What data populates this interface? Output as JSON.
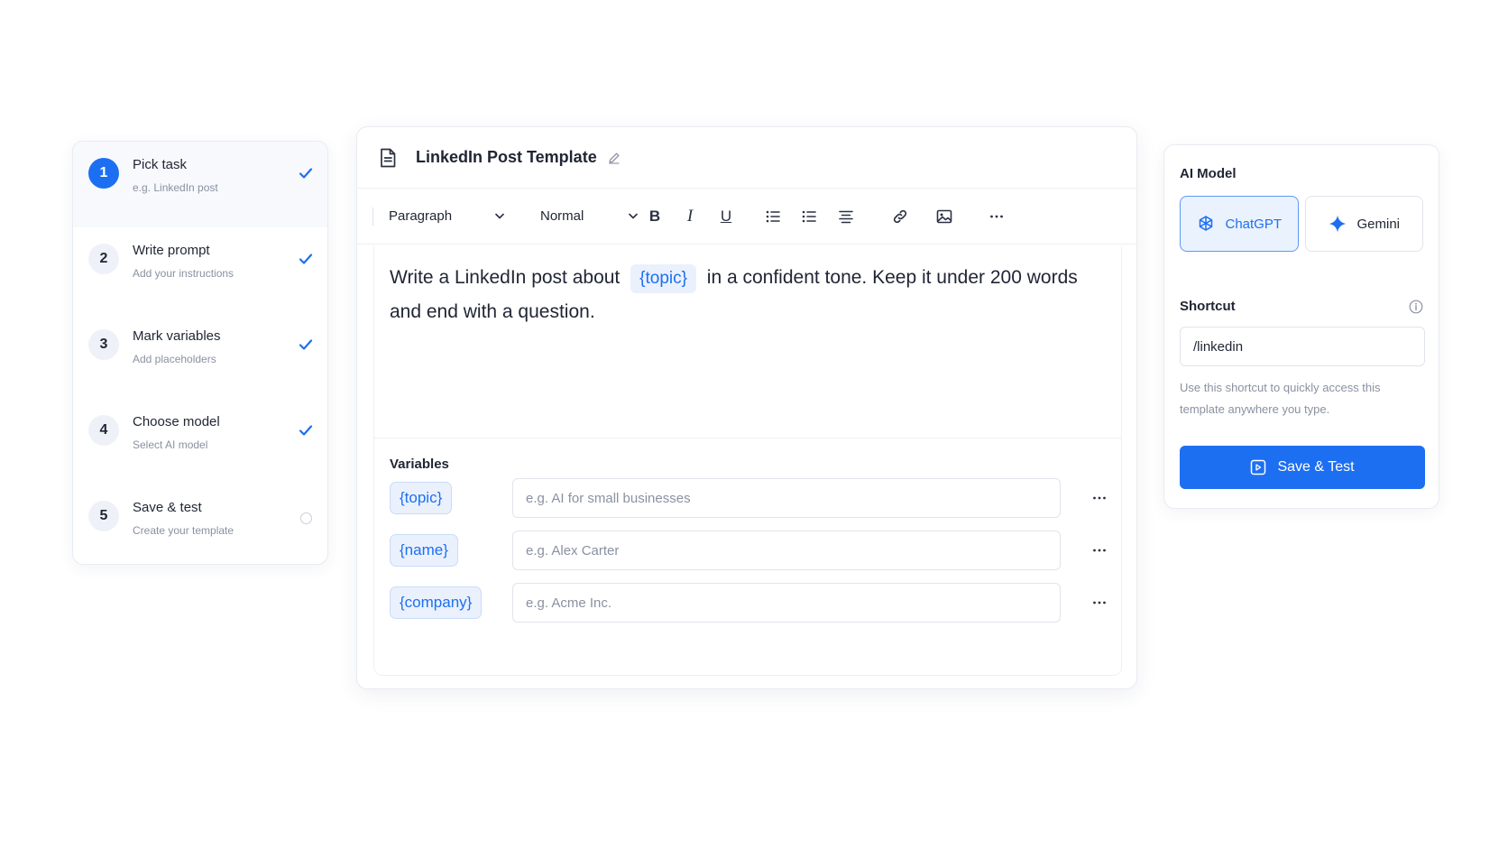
{
  "steps": [
    {
      "number": "1",
      "title": "Pick task",
      "subtitle": "e.g. LinkedIn post",
      "status": "done"
    },
    {
      "number": "2",
      "title": "Write prompt",
      "subtitle": "Add your instructions",
      "status": "done"
    },
    {
      "number": "3",
      "title": "Mark variables",
      "subtitle": "Add placeholders",
      "status": "done"
    },
    {
      "number": "4",
      "title": "Choose model",
      "subtitle": "Select AI model",
      "status": "done"
    },
    {
      "number": "5",
      "title": "Save & test",
      "subtitle": "Create your template",
      "status": "pending"
    }
  ],
  "editor": {
    "title": "LinkedIn Post Template",
    "toolbar": {
      "block_style": "Paragraph",
      "text_size": "Normal",
      "bold": "B",
      "italic": "I",
      "underline": "U"
    },
    "prompt": {
      "before": "Write a LinkedIn post about",
      "variable": "{topic}",
      "after": "in a confident tone. Keep it under 200 words and end with a question."
    },
    "variables_title": "Variables",
    "variables": [
      {
        "tag": "{topic}",
        "placeholder": "e.g. AI for small businesses"
      },
      {
        "tag": "{name}",
        "placeholder": "e.g. Alex Carter"
      },
      {
        "tag": "{company}",
        "placeholder": "e.g. Acme Inc."
      }
    ]
  },
  "side": {
    "model_label": "AI Model",
    "models": [
      {
        "label": "ChatGPT",
        "selected": true
      },
      {
        "label": "Gemini",
        "selected": false
      }
    ],
    "shortcut_label": "Shortcut",
    "shortcut_value": "/linkedin",
    "help_text": "Use this shortcut to quickly access this template anywhere you type.",
    "save_label": "Save & Test"
  },
  "colors": {
    "accent": "#1d6ff2",
    "chip_bg": "#eaf1fd"
  }
}
